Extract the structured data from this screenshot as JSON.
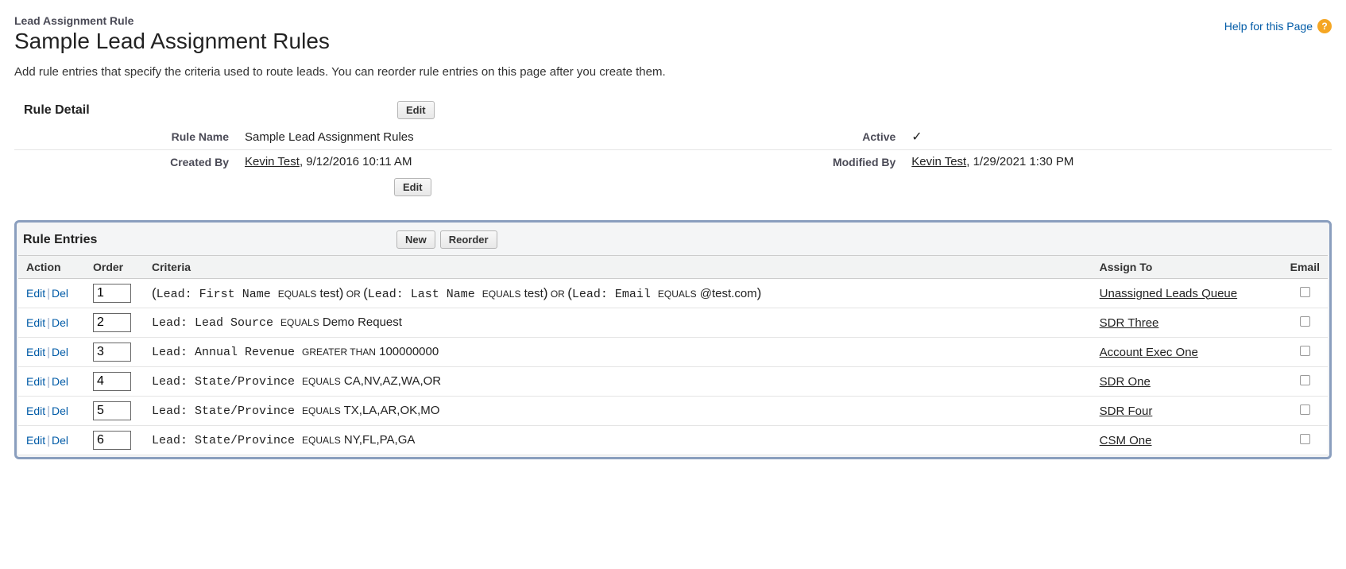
{
  "header": {
    "breadcrumb": "Lead Assignment Rule",
    "title": "Sample Lead Assignment Rules",
    "help_label": "Help for this Page"
  },
  "description": "Add rule entries that specify the criteria used to route leads. You can reorder rule entries on this page after you create them.",
  "detail": {
    "section_title": "Rule Detail",
    "edit_button": "Edit",
    "rule_name_label": "Rule Name",
    "rule_name_value": "Sample Lead Assignment Rules",
    "active_label": "Active",
    "active_checked": "✓",
    "created_by_label": "Created By",
    "created_by_user": "Kevin Test",
    "created_by_time": ", 9/12/2016 10:11 AM",
    "modified_by_label": "Modified By",
    "modified_by_user": "Kevin Test",
    "modified_by_time": ", 1/29/2021 1:30 PM"
  },
  "entries": {
    "section_title": "Rule Entries",
    "new_button": "New",
    "reorder_button": "Reorder",
    "columns": {
      "action": "Action",
      "order": "Order",
      "criteria": "Criteria",
      "assign_to": "Assign To",
      "email": "Email"
    },
    "action_labels": {
      "edit": "Edit",
      "del": "Del"
    },
    "rows": [
      {
        "order": "1",
        "criteria_segments": [
          {
            "class": "paren",
            "text": "("
          },
          {
            "class": "mono",
            "text": "Lead: First Name "
          },
          {
            "class": "op-small",
            "text": "EQUALS"
          },
          {
            "class": "",
            "text": " test"
          },
          {
            "class": "paren",
            "text": ")"
          },
          {
            "class": "op-small",
            "text": " OR "
          },
          {
            "class": "paren",
            "text": "("
          },
          {
            "class": "mono",
            "text": "Lead: Last Name "
          },
          {
            "class": "op-small",
            "text": "EQUALS"
          },
          {
            "class": "",
            "text": " test"
          },
          {
            "class": "paren",
            "text": ")"
          },
          {
            "class": "op-small",
            "text": " OR "
          },
          {
            "class": "paren",
            "text": "("
          },
          {
            "class": "mono",
            "text": "Lead: Email "
          },
          {
            "class": "op-small",
            "text": "EQUALS"
          },
          {
            "class": "",
            "text": " @test.com"
          },
          {
            "class": "paren",
            "text": ")"
          }
        ],
        "assign_to": "Unassigned Leads Queue",
        "email": false
      },
      {
        "order": "2",
        "criteria_segments": [
          {
            "class": "mono",
            "text": "Lead: Lead Source "
          },
          {
            "class": "op-small",
            "text": "EQUALS"
          },
          {
            "class": "",
            "text": " Demo Request"
          }
        ],
        "assign_to": "SDR Three",
        "email": false
      },
      {
        "order": "3",
        "criteria_segments": [
          {
            "class": "mono",
            "text": "Lead: Annual Revenue "
          },
          {
            "class": "op-small",
            "text": "GREATER THAN"
          },
          {
            "class": "",
            "text": " 100000000"
          }
        ],
        "assign_to": "Account Exec One",
        "email": false
      },
      {
        "order": "4",
        "criteria_segments": [
          {
            "class": "mono",
            "text": "Lead: State/Province "
          },
          {
            "class": "op-small",
            "text": "EQUALS"
          },
          {
            "class": "",
            "text": " CA,NV,AZ,WA,OR"
          }
        ],
        "assign_to": "SDR One",
        "email": false
      },
      {
        "order": "5",
        "criteria_segments": [
          {
            "class": "mono",
            "text": "Lead: State/Province "
          },
          {
            "class": "op-small",
            "text": "EQUALS"
          },
          {
            "class": "",
            "text": " TX,LA,AR,OK,MO"
          }
        ],
        "assign_to": "SDR Four",
        "email": false
      },
      {
        "order": "6",
        "criteria_segments": [
          {
            "class": "mono",
            "text": "Lead: State/Province "
          },
          {
            "class": "op-small",
            "text": "EQUALS"
          },
          {
            "class": "",
            "text": " NY,FL,PA,GA"
          }
        ],
        "assign_to": "CSM One",
        "email": false
      }
    ]
  }
}
